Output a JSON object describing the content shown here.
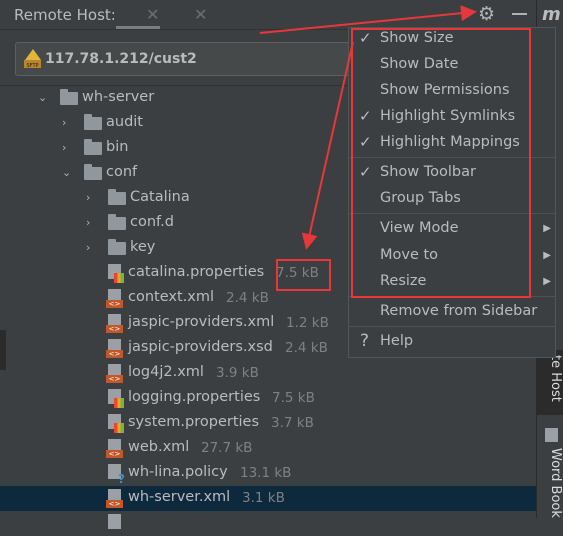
{
  "header": {
    "title": "Remote Host:",
    "tab_close_icons": [
      "close-icon",
      "close-icon"
    ],
    "gear_icon": "gear-icon",
    "minimize_icon": "minus-icon",
    "logo": "m"
  },
  "path": {
    "icon": "sftp-icon",
    "value": "117.78.1.212/cust2"
  },
  "tree": [
    {
      "name": "wh-server",
      "type": "folder",
      "expanded": true,
      "depth": 0
    },
    {
      "name": "audit",
      "type": "folder",
      "expanded": false,
      "depth": 1
    },
    {
      "name": "bin",
      "type": "folder",
      "expanded": false,
      "depth": 1
    },
    {
      "name": "conf",
      "type": "folder",
      "expanded": true,
      "depth": 1
    },
    {
      "name": "Catalina",
      "type": "folder",
      "expanded": false,
      "depth": 2
    },
    {
      "name": "conf.d",
      "type": "folder",
      "expanded": false,
      "depth": 2
    },
    {
      "name": "key",
      "type": "folder",
      "expanded": false,
      "depth": 2
    },
    {
      "name": "catalina.properties",
      "type": "properties",
      "size": "7.5 kB",
      "depth": 3
    },
    {
      "name": "context.xml",
      "type": "xml",
      "size": "2.4 kB",
      "depth": 3
    },
    {
      "name": "jaspic-providers.xml",
      "type": "xml",
      "size": "1.2 kB",
      "depth": 3
    },
    {
      "name": "jaspic-providers.xsd",
      "type": "xml",
      "size": "2.4 kB",
      "depth": 3
    },
    {
      "name": "log4j2.xml",
      "type": "xml",
      "size": "3.9 kB",
      "depth": 3
    },
    {
      "name": "logging.properties",
      "type": "properties",
      "size": "7.5 kB",
      "depth": 3
    },
    {
      "name": "system.properties",
      "type": "properties",
      "size": "3.7 kB",
      "depth": 3
    },
    {
      "name": "web.xml",
      "type": "xml",
      "size": "27.7 kB",
      "depth": 3
    },
    {
      "name": "wh-lina.policy",
      "type": "unknown",
      "size": "13.1 kB",
      "depth": 3
    },
    {
      "name": "wh-server.xml",
      "type": "xml",
      "size": "3.1 kB",
      "depth": 3,
      "selected": true
    }
  ],
  "menu": {
    "items": [
      {
        "label": "Show Size",
        "checked": true
      },
      {
        "label": "Show Date",
        "checked": false
      },
      {
        "label": "Show Permissions",
        "checked": false
      },
      {
        "label": "Highlight Symlinks",
        "checked": true
      },
      {
        "label": "Highlight Mappings",
        "checked": true
      },
      {
        "label": "Show Toolbar",
        "checked": true
      },
      {
        "label": "Group Tabs",
        "checked": false
      },
      {
        "label": "View Mode",
        "submenu": true
      },
      {
        "label": "Move to",
        "submenu": true
      },
      {
        "label": "Resize",
        "submenu": true
      },
      {
        "label": "Remove from Sidebar"
      },
      {
        "label": "Help",
        "icon": "question-icon"
      }
    ]
  },
  "sidebar": {
    "tabs": [
      "te Host",
      "Word Book"
    ]
  },
  "annotation_color": "#e8373a",
  "colors": {
    "background": "#3c3f41",
    "selection": "#0d293e",
    "text": "#bbbbbb"
  }
}
